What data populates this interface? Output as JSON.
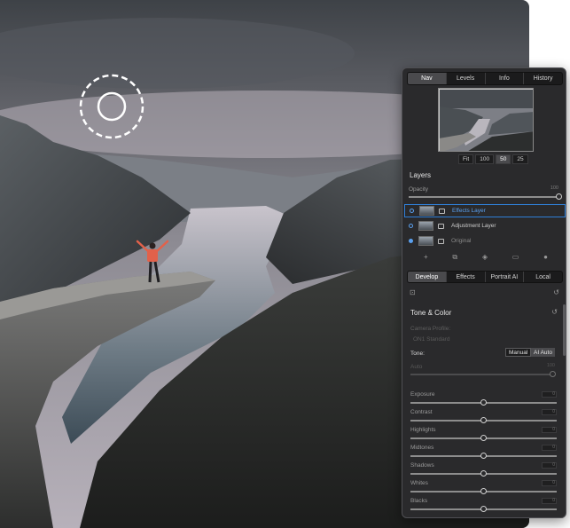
{
  "panel": {
    "top_tabs": [
      {
        "label": "Nav",
        "active": true
      },
      {
        "label": "Levels",
        "active": false
      },
      {
        "label": "Info",
        "active": false
      },
      {
        "label": "History",
        "active": false
      }
    ],
    "zoom": [
      {
        "label": "Fit",
        "active": false
      },
      {
        "label": "100",
        "active": false
      },
      {
        "label": "50",
        "active": true
      },
      {
        "label": "25",
        "active": false
      }
    ],
    "layers": {
      "title": "Layers",
      "opacity_label": "Opacity",
      "opacity_value": "100",
      "items": [
        {
          "name": "Effects Layer",
          "selected": true
        },
        {
          "name": "Adjustment Layer",
          "selected": false
        },
        {
          "name": "Original",
          "selected": false
        }
      ]
    },
    "develop_tabs": [
      {
        "label": "Develop",
        "active": true
      },
      {
        "label": "Effects",
        "active": false
      },
      {
        "label": "Portrait AI",
        "active": false
      },
      {
        "label": "Local",
        "active": false
      }
    ],
    "tone_color": {
      "title": "Tone & Color",
      "camera_profile_label": "Camera Profile:",
      "camera_profile_value": "ON1 Standard",
      "tone_label": "Tone:",
      "tone_buttons": [
        {
          "label": "Manual",
          "active": true
        },
        {
          "label": "AI Auto",
          "active": false
        }
      ],
      "auto_label": "Auto",
      "auto_value": "100",
      "sliders": [
        {
          "label": "Exposure",
          "value": "0"
        },
        {
          "label": "Contrast",
          "value": "0"
        },
        {
          "label": "Highlights",
          "value": "0"
        },
        {
          "label": "Midtones",
          "value": "0"
        },
        {
          "label": "Shadows",
          "value": "0"
        },
        {
          "label": "Whites",
          "value": "0"
        },
        {
          "label": "Blacks",
          "value": "0"
        }
      ]
    }
  },
  "colors": {
    "panel_bg": "#2a2a2c",
    "accent_blue": "#2f7fd8",
    "jacket": "#e2614a"
  },
  "icons": [
    "brush-circle-icon",
    "add-layer-icon",
    "duplicate-layer-icon",
    "paint-bucket-icon",
    "trash-icon",
    "settings-icon",
    "preset-icon",
    "reset-icon"
  ]
}
